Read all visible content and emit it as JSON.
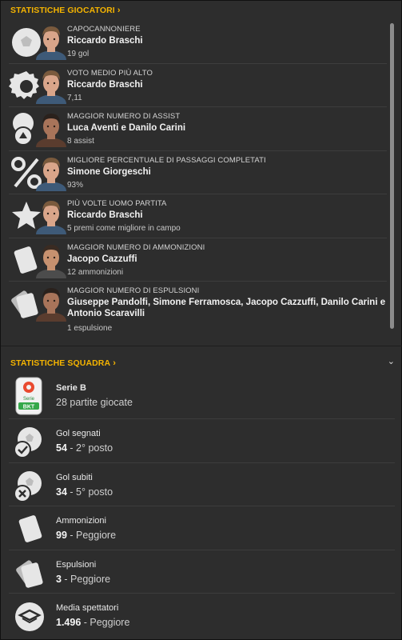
{
  "player_section": {
    "title": "STATISTICHE GIOCATORI",
    "chevron": "›",
    "collapse_icon": "⌄"
  },
  "players": [
    {
      "category": "CAPOCANNONIERE",
      "name": "Riccardo Braschi",
      "value": "19 gol",
      "icon": "ball-icon",
      "face": "light"
    },
    {
      "category": "VOTO MEDIO PIÙ ALTO",
      "name": "Riccardo Braschi",
      "value": "7,11",
      "icon": "rating-badge-icon",
      "face": "light"
    },
    {
      "category": "MAGGIOR NUMERO DI ASSIST",
      "name": "Luca Aventi e Danilo Carini",
      "value": "8 assist",
      "icon": "assist-icon",
      "face": "dark"
    },
    {
      "category": "MIGLIORE PERCENTUALE DI PASSAGGI COMPLETATI",
      "name": "Simone Giorgeschi",
      "value": "93%",
      "icon": "percent-icon",
      "face": "light"
    },
    {
      "category": "PIÙ VOLTE UOMO PARTITA",
      "name": "Riccardo Braschi",
      "value": "5 premi come migliore in campo",
      "icon": "star-icon",
      "face": "light"
    },
    {
      "category": "MAGGIOR NUMERO DI AMMONIZIONI",
      "name": "Jacopo Cazzuffi",
      "value": "12 ammonizioni",
      "icon": "yellow-card-icon",
      "face": "medium"
    },
    {
      "category": "MAGGIOR NUMERO DI ESPULSIONI",
      "name": "Giuseppe Pandolfi, Simone Ferramosca, Jacopo Cazzuffi, Danilo Carini e Antonio Scaravilli",
      "value": "1 espulsione",
      "icon": "red-card-icon",
      "face": "dark"
    }
  ],
  "team_section": {
    "title": "STATISTICHE SQUADRA",
    "chevron": "›",
    "collapse_icon": "⌄"
  },
  "team": {
    "league": {
      "name": "Serie B",
      "detail": "28 partite giocate",
      "logo_text": "Serie",
      "logo_sub": "BKT"
    },
    "goals_scored": {
      "label": "Gol segnati",
      "value": "54",
      "rank": " - 2° posto"
    },
    "goals_conceded": {
      "label": "Gol subiti",
      "value": "34",
      "rank": " - 5° posto"
    },
    "yellow_cards": {
      "label": "Ammonizioni",
      "value": "99",
      "rank": " - Peggiore"
    },
    "red_cards": {
      "label": "Espulsioni",
      "value": "3",
      "rank": " - Peggiore"
    },
    "attendance": {
      "label": "Media spettatori",
      "value": "1.496",
      "rank": " - Peggiore"
    }
  },
  "colors": {
    "accent": "#f5b400",
    "background": "#2d2d2d",
    "icon": "#e6e6e6"
  }
}
